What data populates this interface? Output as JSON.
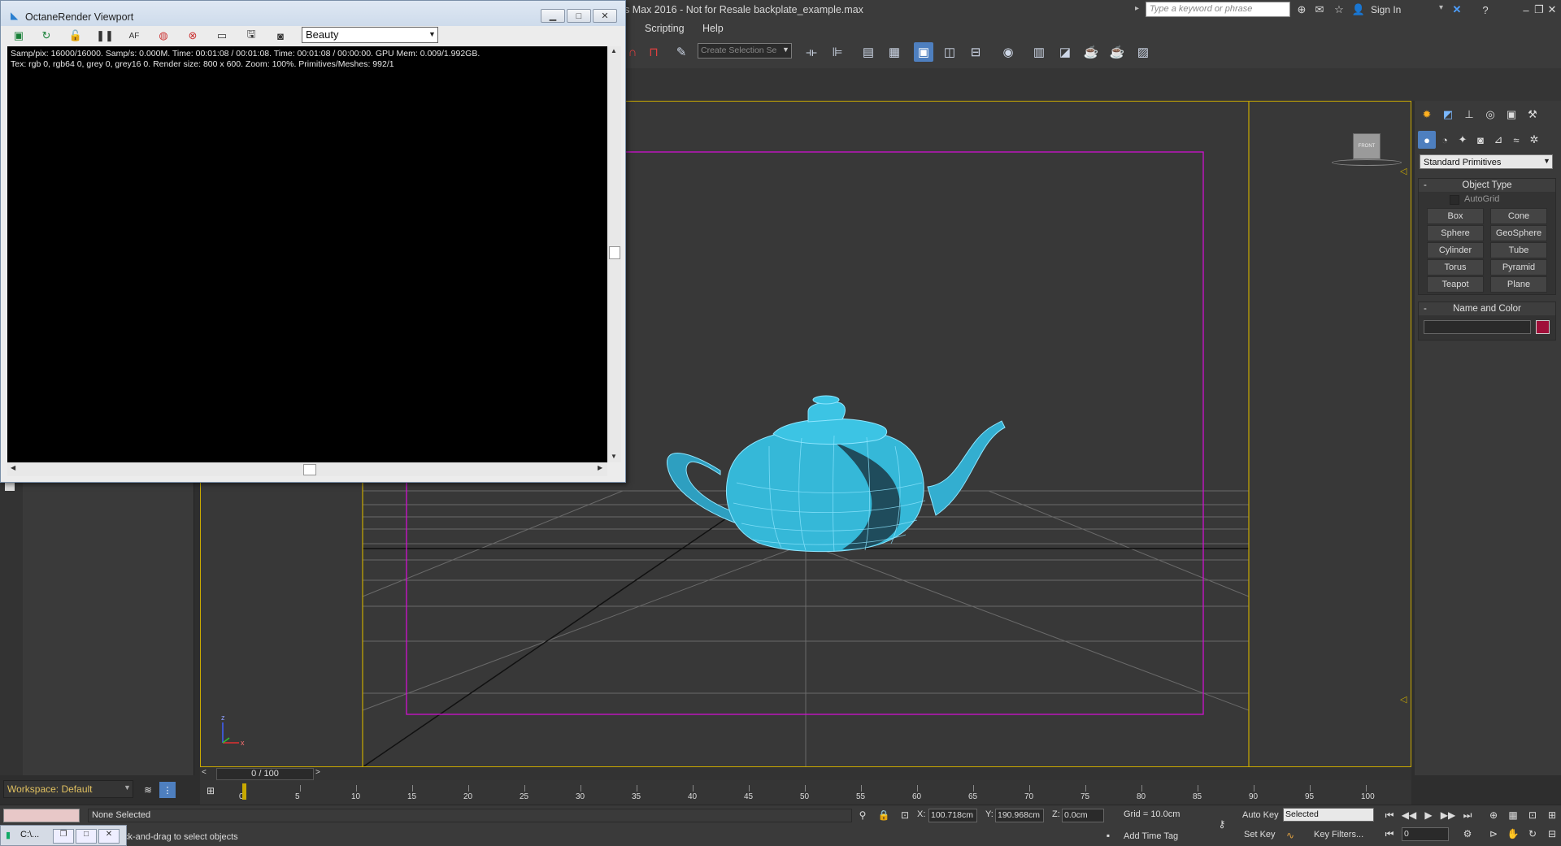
{
  "app": {
    "title_fragment": "s Max 2016 - Not for Resale   backplate_example.max",
    "search_placeholder": "Type a keyword or phrase",
    "sign_in": "Sign In"
  },
  "menu": {
    "items": [
      "Scripting",
      "Help"
    ]
  },
  "toolbar": {
    "selection_set_placeholder": "Create Selection Se"
  },
  "octane": {
    "title": "OctaneRender Viewport",
    "pass": "Beauty",
    "status_line1": "Samp/pix: 16000/16000.   Samp/s: 0.000M.   Time: 00:01:08 / 00:01:08.   Time: 00:01:08 / 00:00:00.   GPU Mem: 0.009/1.992GB.",
    "status_line2": "Tex: rgb 0, rgb64 0, grey 0, grey16 0.   Render size: 800 x 600.   Zoom: 100%.   Primitives/Meshes: 992/1"
  },
  "viewcube": {
    "label": "FRONT"
  },
  "command_panel": {
    "category": "Standard Primitives",
    "object_type_title": "Object Type",
    "autogrid": "AutoGrid",
    "primitives": [
      "Box",
      "Cone",
      "Sphere",
      "GeoSphere",
      "Cylinder",
      "Tube",
      "Torus",
      "Pyramid",
      "Teapot",
      "Plane"
    ],
    "name_color_title": "Name and Color",
    "object_color": "#a0103a"
  },
  "workspace": {
    "label": "Workspace: Default"
  },
  "timeline": {
    "frame_display": "0 / 100",
    "ticks": [
      "0",
      "5",
      "10",
      "15",
      "20",
      "25",
      "30",
      "35",
      "40",
      "45",
      "50",
      "55",
      "60",
      "65",
      "70",
      "75",
      "80",
      "85",
      "90",
      "95",
      "100"
    ]
  },
  "status": {
    "selection": "None Selected",
    "prompt": "ck-and-drag to select objects",
    "taskbar_item": "C:\\...",
    "x_label": "X:",
    "x_value": "100.718cm",
    "y_label": "Y:",
    "y_value": "190.968cm",
    "z_label": "Z:",
    "z_value": "0.0cm",
    "grid": "Grid = 10.0cm",
    "add_time_tag": "Add Time Tag",
    "auto_key": "Auto Key",
    "set_key": "Set Key",
    "key_mode": "Selected",
    "key_filters": "Key Filters...",
    "current_frame": "0"
  },
  "colors": {
    "teapot": "#35b8d8",
    "safe_frame_outer": "#c9a900",
    "safe_frame_inner": "#d010d0"
  }
}
